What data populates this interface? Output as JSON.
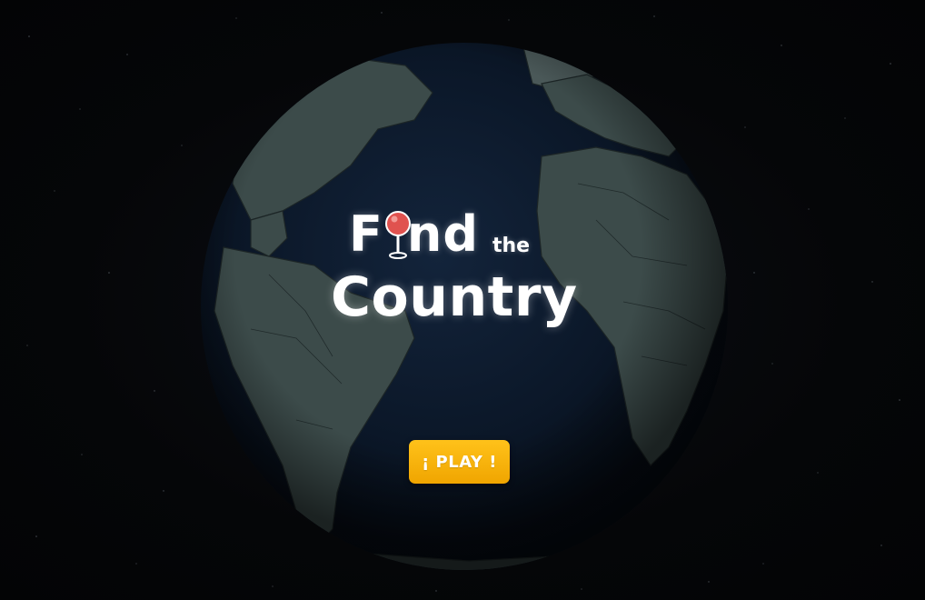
{
  "title": {
    "word1_start": "F",
    "word1_end": "nd",
    "word2": "the",
    "word3": "Country"
  },
  "play_button": {
    "label": "¡ PLAY !"
  },
  "colors": {
    "background": "#050608",
    "ocean": "#0c1a2e",
    "land": "#3b4a4a",
    "pin": "#e0524f",
    "button": "#f6b308",
    "text": "#ffffff"
  },
  "icons": {
    "title_pin": "map-pin-icon",
    "globe": "earth-globe"
  }
}
